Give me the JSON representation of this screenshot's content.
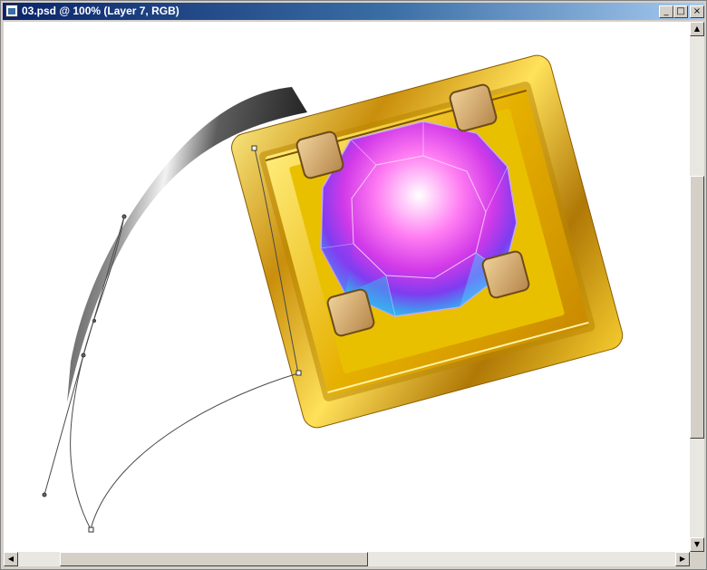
{
  "window": {
    "title": "03.psd @ 100% (Layer 7, RGB)",
    "controls": {
      "minimize": "_",
      "maximize": "□",
      "close": "×"
    }
  },
  "scrollbars": {
    "up_arrow": "▲",
    "down_arrow": "▼",
    "left_arrow": "◀",
    "right_arrow": "▶"
  },
  "colors": {
    "titlebar_start": "#0a246a",
    "titlebar_end": "#a6caf0",
    "gold": "#e8b418",
    "gem_pink": "#ff66ee",
    "metal_gray": "#6e6e6e"
  }
}
